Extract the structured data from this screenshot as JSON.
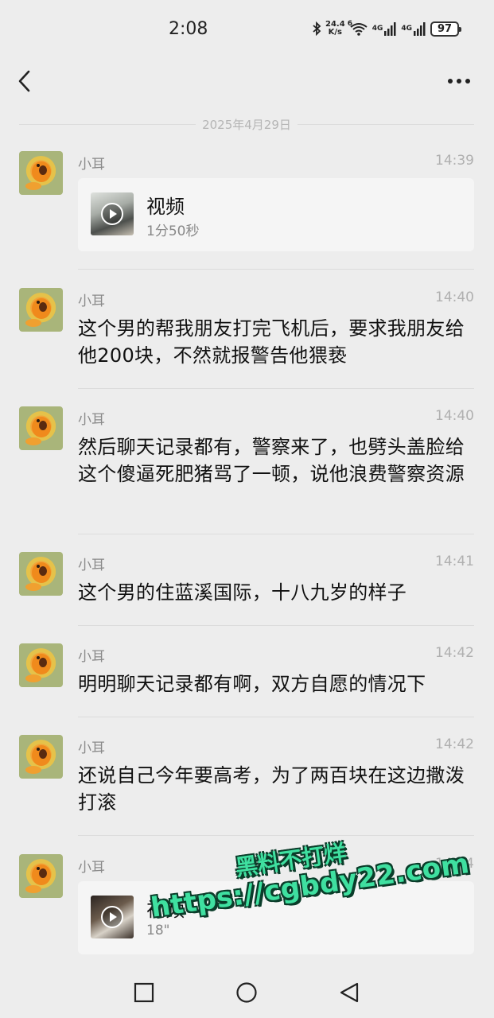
{
  "status_bar": {
    "time": "2:08",
    "net_speed_value": "24.4",
    "net_speed_unit": "K/s",
    "wifi_badge": "6",
    "net_type_1": "4G",
    "net_type_2": "4G",
    "battery": "97"
  },
  "nav": {
    "back_icon": "chevron-left-icon",
    "more_icon": "more-dots-icon"
  },
  "date_divider": "2025年4月29日",
  "messages": [
    {
      "sender": "小耳",
      "time": "14:39",
      "type": "video",
      "video_title": "视频",
      "video_duration": "1分50秒"
    },
    {
      "sender": "小耳",
      "time": "14:40",
      "type": "text",
      "text": "这个男的帮我朋友打完飞机后，要求我朋友给他200块，不然就报警告他猥亵"
    },
    {
      "sender": "小耳",
      "time": "14:40",
      "type": "text",
      "text": "然后聊天记录都有，警察来了，也劈头盖脸给这个傻逼死肥猪骂了一顿，说他浪费警察资源"
    },
    {
      "sender": "小耳",
      "time": "14:41",
      "type": "text",
      "text": "这个男的住蓝溪国际，十八九岁的样子"
    },
    {
      "sender": "小耳",
      "time": "14:42",
      "type": "text",
      "text": "明明聊天记录都有啊，双方自愿的情况下"
    },
    {
      "sender": "小耳",
      "time": "14:42",
      "type": "text",
      "text": "还说自己今年要高考，为了两百块在这边撒泼打滚"
    },
    {
      "sender": "小耳",
      "time": "14:44",
      "type": "video",
      "video_title": "视频",
      "video_duration": "18\""
    }
  ],
  "watermark": {
    "line1": "黑料不打烊",
    "line2": "https://cgbdy22.com"
  },
  "bottom_nav": {
    "recents_icon": "square-icon",
    "home_icon": "circle-icon",
    "back_icon": "triangle-back-icon"
  },
  "colors": {
    "background": "#ededed",
    "card": "#f5f5f5",
    "watermark": "#3fe0a0"
  }
}
